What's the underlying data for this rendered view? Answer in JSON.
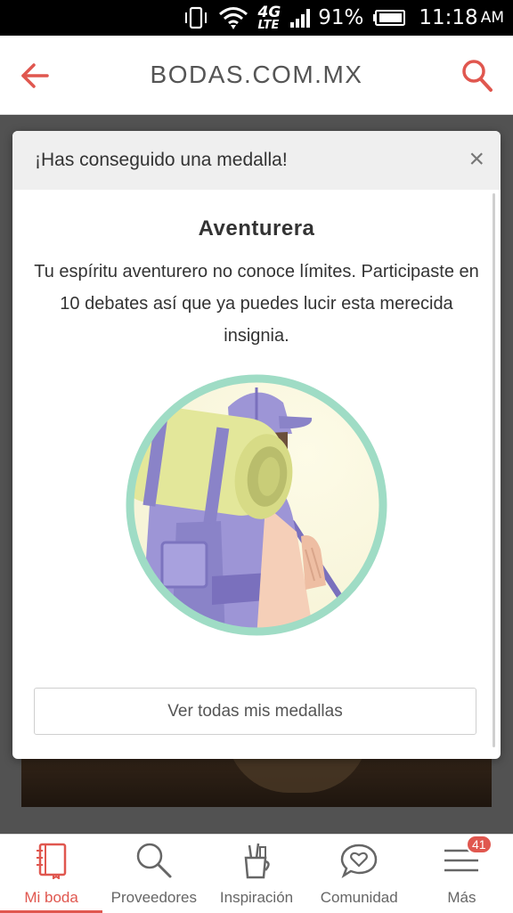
{
  "status_bar": {
    "network": "4G",
    "network_sub": "LTE",
    "battery": "91%",
    "time": "11:18",
    "ampm": "AM"
  },
  "header": {
    "title": "BODAS.COM.MX",
    "back_icon": "arrow-left-icon",
    "search_icon": "search-icon"
  },
  "modal": {
    "header_title": "¡Has conseguido una medalla!",
    "close_label": "×",
    "medal_name": "Aventurera",
    "description": "Tu espíritu aventurero no conoce límites. Participaste en 10 debates así que ya puedes lucir esta merecida insignia.",
    "button_label": "Ver todas mis medallas"
  },
  "bottom_nav": {
    "items": [
      {
        "label": "Mi boda",
        "icon": "notebook-icon",
        "active": true
      },
      {
        "label": "Proveedores",
        "icon": "search-icon",
        "active": false
      },
      {
        "label": "Inspiración",
        "icon": "brushes-cup-icon",
        "active": false
      },
      {
        "label": "Comunidad",
        "icon": "chat-heart-icon",
        "active": false
      },
      {
        "label": "Más",
        "icon": "menu-icon",
        "active": false,
        "badge": "41"
      }
    ]
  },
  "colors": {
    "accent": "#e0574f",
    "modal_header_bg": "#efefef",
    "badge_ring": "#9fdcc5"
  }
}
